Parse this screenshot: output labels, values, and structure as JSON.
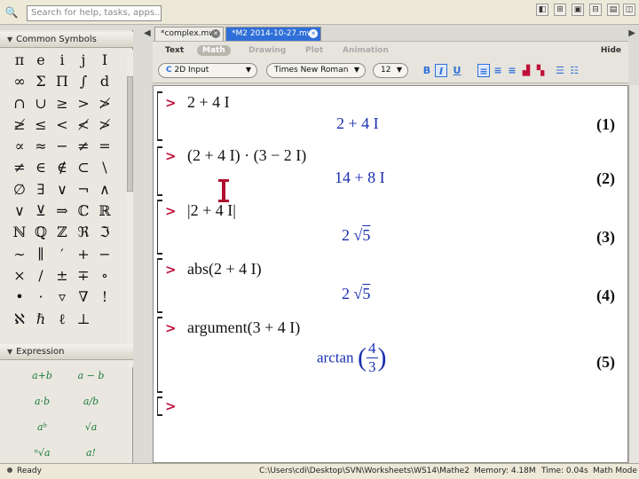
{
  "search": {
    "placeholder": "Search for help, tasks, apps..."
  },
  "palettes": {
    "common_symbols": {
      "title": "Common Symbols",
      "symbols": [
        "π",
        "e",
        "i",
        "j",
        "I",
        "∞",
        "Σ",
        "Π",
        "∫",
        "d",
        "∩",
        "∪",
        "≥",
        ">",
        "≯",
        "≱",
        "≤",
        "<",
        "≮",
        "≯",
        "∝",
        "≈",
        "−",
        "≠",
        "=",
        "≠",
        "∈",
        "∉",
        "⊂",
        "\\",
        "∅",
        "∃",
        "∨",
        "¬",
        "∧",
        "∨",
        "⊻",
        "⇒",
        "ℂ",
        "ℝ",
        "ℕ",
        "ℚ",
        "ℤ",
        "ℜ",
        "ℑ",
        "∼",
        "∥",
        "′",
        "+",
        "−",
        "×",
        "/",
        "±",
        "∓",
        "∘",
        "•",
        "·",
        "▿",
        "∇",
        "!",
        "ℵ",
        "ℏ",
        "ℓ",
        "⊥"
      ]
    },
    "expression": {
      "title": "Expression",
      "items": [
        "a+b",
        "a − b",
        "a·b",
        "a/b",
        "aᵇ",
        "√a",
        "ⁿ√a",
        "a!"
      ]
    }
  },
  "tabs": [
    {
      "label": "*complex.mw",
      "active": false
    },
    {
      "label": "*M2 2014-10-27.mw",
      "active": true
    }
  ],
  "context_bar": {
    "modes": [
      "Text",
      "Math",
      "Drawing",
      "Plot",
      "Animation"
    ],
    "active_mode": "Math",
    "hide_label": "Hide",
    "input_mode": "2D Input",
    "font": "Times New Roman",
    "size": "12",
    "format_buttons": [
      "B",
      "I",
      "U"
    ]
  },
  "worksheet": {
    "prompt": ">",
    "entries": [
      {
        "input": "2 + 4 I",
        "output": "2 + 4 I",
        "label": "(1)"
      },
      {
        "input": "(2 + 4 I) · (3 − 2 I)",
        "output": "14 + 8 I",
        "label": "(2)"
      },
      {
        "input": "|2 + 4 I|",
        "output_coef": "2",
        "output_root": "5",
        "label": "(3)"
      },
      {
        "input": "abs(2 + 4 I)",
        "output_coef": "2",
        "output_root": "5",
        "label": "(4)"
      },
      {
        "input": "argument(3 + 4 I)",
        "output_fn": "arctan",
        "output_num": "4",
        "output_den": "3",
        "label": "(5)"
      }
    ]
  },
  "status": {
    "ready": "Ready",
    "path": "C:\\Users\\cdi\\Desktop\\SVN\\Worksheets\\WS14\\Mathe2",
    "memory": "Memory: 4.18M",
    "time": "Time: 0.04s",
    "mode": "Math Mode"
  },
  "colors": {
    "prompt": "#c0103a",
    "output": "#1a2fb0",
    "active_tab": "#2e6fd8"
  }
}
